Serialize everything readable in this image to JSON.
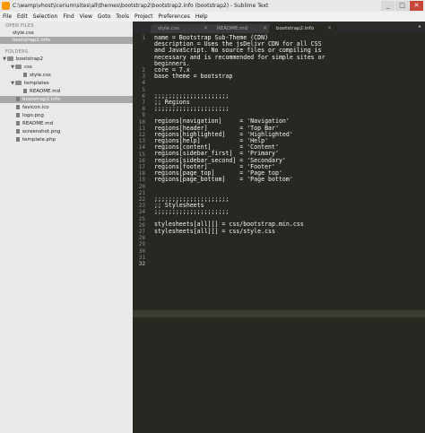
{
  "window": {
    "title": "C:\\wamp\\vhost\\icerium\\sites\\all\\themes\\bootstrap2\\bootstrap2.info (bootstrap2) - Sublime Text",
    "min": "_",
    "max": "□",
    "close": "✕"
  },
  "menu": [
    "File",
    "Edit",
    "Selection",
    "Find",
    "View",
    "Goto",
    "Tools",
    "Project",
    "Preferences",
    "Help"
  ],
  "sidebar": {
    "open_files_title": "OPEN FILES",
    "open_files": [
      "style.css",
      "bootstrap2.info"
    ],
    "folders_title": "FOLDERS",
    "tree": [
      {
        "label": "bootstrap2",
        "type": "folder"
      },
      {
        "label": "css",
        "type": "folder"
      },
      {
        "label": "style.css",
        "type": "file"
      },
      {
        "label": "templates",
        "type": "folder"
      },
      {
        "label": "README.md",
        "type": "file"
      },
      {
        "label": "bootstrap2.info",
        "type": "file"
      },
      {
        "label": "favicon.ico",
        "type": "file"
      },
      {
        "label": "logo.png",
        "type": "file"
      },
      {
        "label": "README.md",
        "type": "file"
      },
      {
        "label": "screenshot.png",
        "type": "file"
      },
      {
        "label": "template.php",
        "type": "file"
      }
    ]
  },
  "tabs": [
    {
      "label": "style.css",
      "close": "✕"
    },
    {
      "label": "README.md",
      "close": "✕"
    },
    {
      "label": "bootstrap2.info",
      "close": "✕"
    }
  ],
  "tab_menu": "▸",
  "editor": {
    "lines": [
      "name = Bootstrap Sub-Theme (CDN)",
      "description = Uses the jsDelivr CDN for all CSS",
      "and JavaScript. No source files or compiling is",
      "necessary and is recommended for simple sites or",
      "beginners.",
      "core = 7.x",
      "base theme = bootstrap",
      "",
      "",
      ";;;;;;;;;;;;;;;;;;;;;",
      ";; Regions",
      ";;;;;;;;;;;;;;;;;;;;;",
      "",
      "regions[navigation]     = 'Navigation'",
      "regions[header]         = 'Top Bar'",
      "regions[highlighted]    = 'Highlighted'",
      "regions[help]           = 'Help'",
      "regions[content]        = 'Content'",
      "regions[sidebar_first]  = 'Primary'",
      "regions[sidebar_second] = 'Secondary'",
      "regions[footer]         = 'Footer'",
      "regions[page_top]       = 'Page top'",
      "regions[page_bottom]    = 'Page bottom'",
      "",
      "",
      ";;;;;;;;;;;;;;;;;;;;;",
      ";; Stylesheets",
      ";;;;;;;;;;;;;;;;;;;;;",
      "",
      "stylesheets[all][] = css/bootstrap.min.css",
      "stylesheets[all][] = css/style.css",
      "",
      ""
    ],
    "line_numbers": [
      "1",
      "",
      "",
      "",
      "",
      "2",
      "3",
      "4",
      "5",
      "6",
      "7",
      "8",
      "9",
      "10",
      "11",
      "12",
      "13",
      "14",
      "15",
      "16",
      "17",
      "18",
      "19",
      "20",
      "21",
      "22",
      "23",
      "24",
      "25",
      "26",
      "27",
      "28",
      "29",
      "30",
      "31",
      "32"
    ]
  }
}
